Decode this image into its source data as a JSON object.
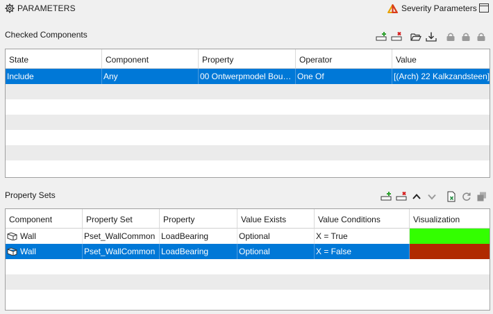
{
  "header": {
    "title": "PARAMETERS",
    "severity_label": "Severity Parameters",
    "accent_color": "#d93a1c"
  },
  "checked_components": {
    "title": "Checked Components",
    "columns": [
      "State",
      "Component",
      "Property",
      "Operator",
      "Value"
    ],
    "rows": [
      [
        "Include",
        "Any",
        "00 Ontwerpmodel Bou…",
        "One Of",
        "[(Arch) 22 Kalkzandsteen]"
      ]
    ],
    "selected_row": 0,
    "toolbar_icons": [
      "add-row-icon",
      "delete-row-icon",
      "open-folder-icon",
      "download-icon",
      "lock-icon",
      "lock-icon",
      "lock-icon"
    ]
  },
  "property_sets": {
    "title": "Property Sets",
    "columns": [
      "Component",
      "Property Set",
      "Property",
      "Value Exists",
      "Value Conditions",
      "Visualization"
    ],
    "rows": [
      {
        "component": "Wall",
        "property_set": "Pset_WallCommon",
        "property": "LoadBearing",
        "value_exists": "Optional",
        "value_conditions": "X = True",
        "visualization_color": "#33ff00"
      },
      {
        "component": "Wall",
        "property_set": "Pset_WallCommon",
        "property": "LoadBearing",
        "value_exists": "Optional",
        "value_conditions": "X = False",
        "visualization_color": "#b02a00"
      }
    ],
    "selected_row": 1,
    "toolbar_icons": [
      "add-row-icon",
      "delete-row-icon",
      "move-up-icon",
      "move-down-icon",
      "export-excel-icon",
      "refresh-icon",
      "copy-icon"
    ]
  },
  "colors": {
    "selection": "#0078d7",
    "add_green": "#2ca02c",
    "delete_red": "#d62020"
  }
}
